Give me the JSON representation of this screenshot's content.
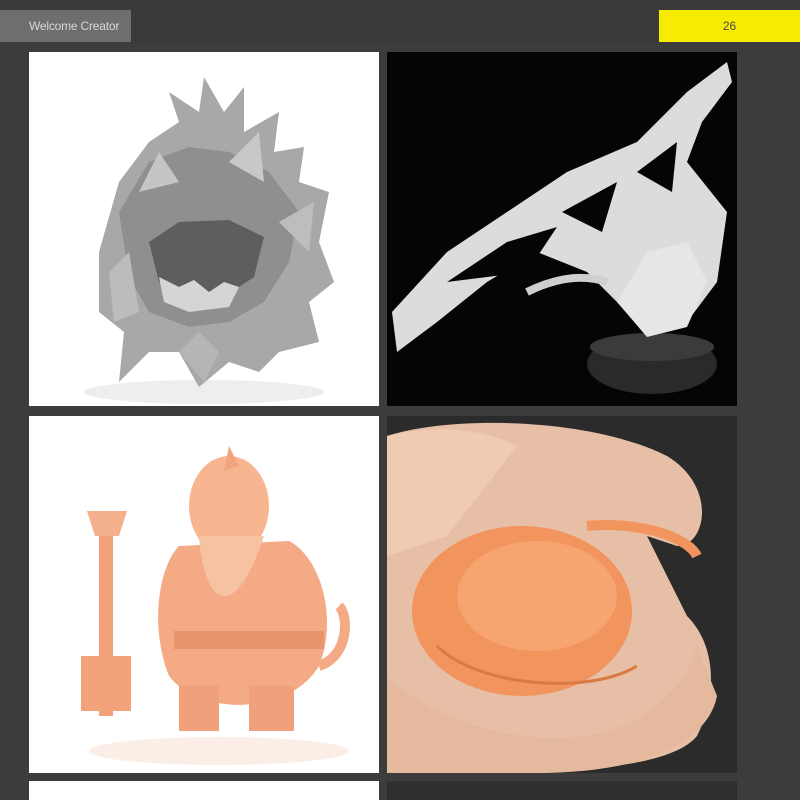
{
  "header": {
    "title": "Welcome Creator",
    "page_number": "26"
  },
  "gallery": {
    "tiles": [
      {
        "subject": "grey helmet miniature",
        "background": "white"
      },
      {
        "subject": "white winged dragon miniature",
        "background": "black"
      },
      {
        "subject": "orange dwarf miniature",
        "background": "white"
      },
      {
        "subject": "hand squeezing flexible orange print",
        "background": "dark"
      }
    ]
  },
  "colors": {
    "accent": "#f6ec00",
    "title_pill": "#6e6e70",
    "page_bg": "#3c3c3c"
  }
}
